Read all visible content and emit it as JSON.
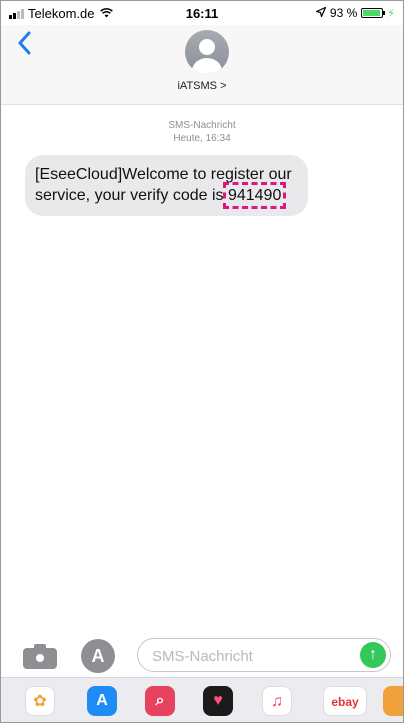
{
  "status_bar": {
    "carrier": "Telekom.de",
    "time": "16:11",
    "battery_level": "93 %",
    "battery_fraction": 0.93,
    "signal_bars_filled": 2,
    "signal_bars_total": 4,
    "icons": [
      "signal-icon",
      "wifi-icon",
      "location-arrow-icon",
      "battery-icon",
      "charging-bolt-icon"
    ]
  },
  "header": {
    "back_icon": "chevron-left-icon",
    "contact_name": "iATSMS",
    "contact_chevron": ">"
  },
  "thread": {
    "type_label": "SMS-Nachricht",
    "timestamp": "Heute, 16:34",
    "message_prefix": "[EseeCloud]Welcome to register our service, your verify code is ",
    "message_code": "941490",
    "highlight_color": "#e0167d"
  },
  "input_bar": {
    "placeholder": "SMS-Nachricht",
    "apps_glyph": "A",
    "send_glyph": "↑",
    "send_color": "#34c759"
  },
  "app_drawer": {
    "ebay_label": "ebay",
    "items": [
      "photos-app-icon",
      "app-store-icon",
      "search-app-icon",
      "heart-app-icon",
      "music-app-icon",
      "ebay-app-icon",
      "extra-app-icon"
    ]
  },
  "colors": {
    "accent": "#1f7df2",
    "bubble": "#e9e9eb",
    "battery": "#4cd964"
  }
}
